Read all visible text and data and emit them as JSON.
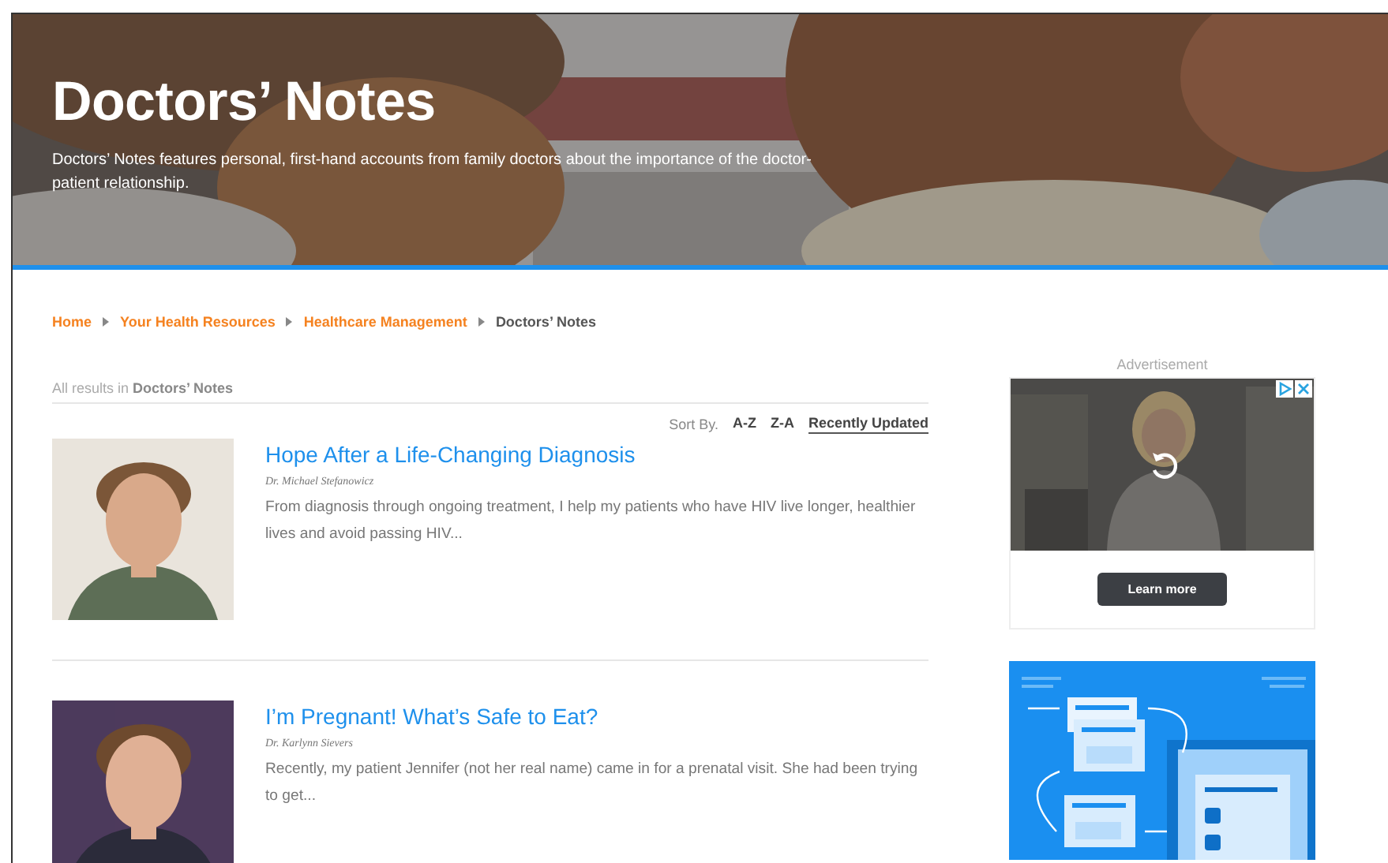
{
  "hero": {
    "title": "Doctors’ Notes",
    "description": "Doctors’ Notes features personal, first-hand accounts from family doctors about the importance of the doctor-patient relationship."
  },
  "breadcrumb": [
    {
      "label": "Home",
      "current": false
    },
    {
      "label": "Your Health Resources",
      "current": false
    },
    {
      "label": "Healthcare Management",
      "current": false
    },
    {
      "label": "Doctors’ Notes",
      "current": true
    }
  ],
  "results_label": "All results in **Doctors’ Notes**",
  "sort": {
    "label": "Sort By.",
    "options": [
      {
        "label": "A-Z",
        "selected": false
      },
      {
        "label": "Z-A",
        "selected": false
      },
      {
        "label": "Recently Updated",
        "selected": true
      }
    ]
  },
  "articles": [
    {
      "title": "Hope After a Life-Changing Diagnosis",
      "author": "Dr. Michael Stefanowicz",
      "summary": "From diagnosis through ongoing treatment, I help my patients who have HIV live longer, healthier lives and avoid passing HIV..."
    },
    {
      "title": "I’m Pregnant! What’s Safe to Eat?",
      "author": "Dr. Karlynn Sievers",
      "summary": "Recently, my patient Jennifer (not her real name) came in for a prenatal visit. She had been trying to get..."
    }
  ],
  "sidebar": {
    "ad_label": "Advertisement",
    "ads": [
      {
        "kind": "video",
        "button": "Learn more"
      },
      {
        "kind": "illustration"
      }
    ]
  }
}
